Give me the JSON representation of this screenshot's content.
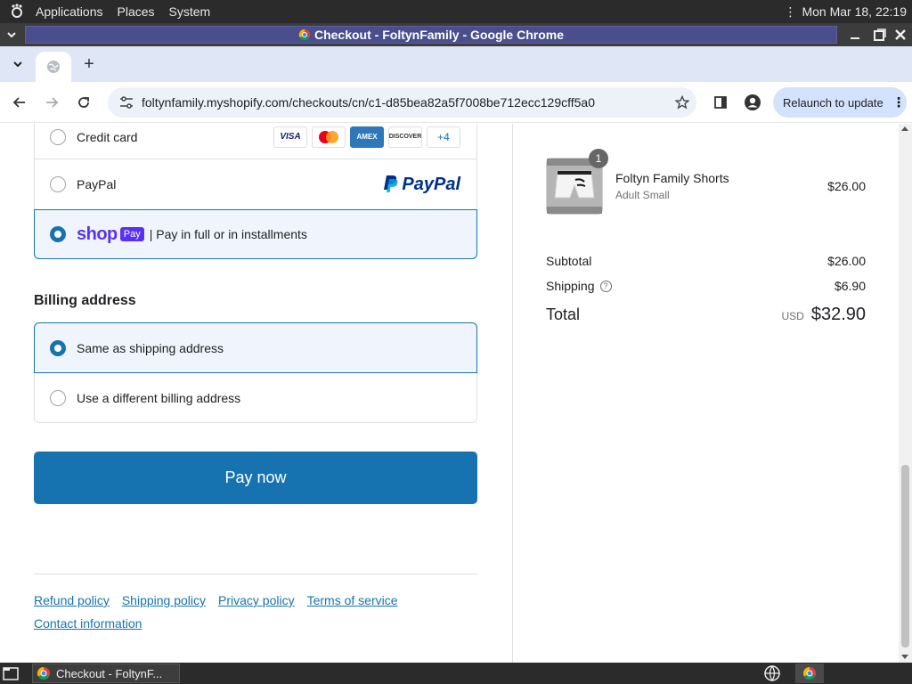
{
  "top_panel": {
    "menus": [
      "Applications",
      "Places",
      "System"
    ],
    "clock": "Mon Mar 18, 22:19"
  },
  "window": {
    "title": "Checkout - FoltynFamily - Google Chrome"
  },
  "toolbar": {
    "url": "foltynfamily.myshopify.com/checkouts/cn/c1-d85bea82a5f7008be712ecc129cff5a0",
    "relaunch_label": "Relaunch to update"
  },
  "payment": {
    "credit_card_label": "Credit card",
    "card_brands": [
      "VISA",
      "",
      "AMEX",
      "DISCOVER",
      "+4"
    ],
    "paypal_label": "PayPal",
    "paypal_logo_text": "PayPal",
    "shop_pay_word": "shop",
    "shop_pay_badge": "Pay",
    "shop_pay_label": "| Pay in full or in installments"
  },
  "billing": {
    "title": "Billing address",
    "same_label": "Same as shipping address",
    "different_label": "Use a different billing address"
  },
  "pay_now_label": "Pay now",
  "footer": {
    "links": [
      "Refund policy",
      "Shipping policy",
      "Privacy policy",
      "Terms of service",
      "Contact information"
    ]
  },
  "summary": {
    "qty": "1",
    "product_name": "Foltyn Family Shorts",
    "variant": "Adult Small",
    "product_price": "$26.00",
    "subtotal_label": "Subtotal",
    "subtotal_value": "$26.00",
    "shipping_label": "Shipping",
    "shipping_value": "$6.90",
    "total_label": "Total",
    "currency": "USD",
    "total_value": "$32.90"
  },
  "taskbar": {
    "item_label": "Checkout - FoltynF..."
  },
  "colors": {
    "accent": "#1773b0",
    "shop_purple": "#5a31f4",
    "paypal_dark": "#003087",
    "paypal_light": "#009cde"
  }
}
